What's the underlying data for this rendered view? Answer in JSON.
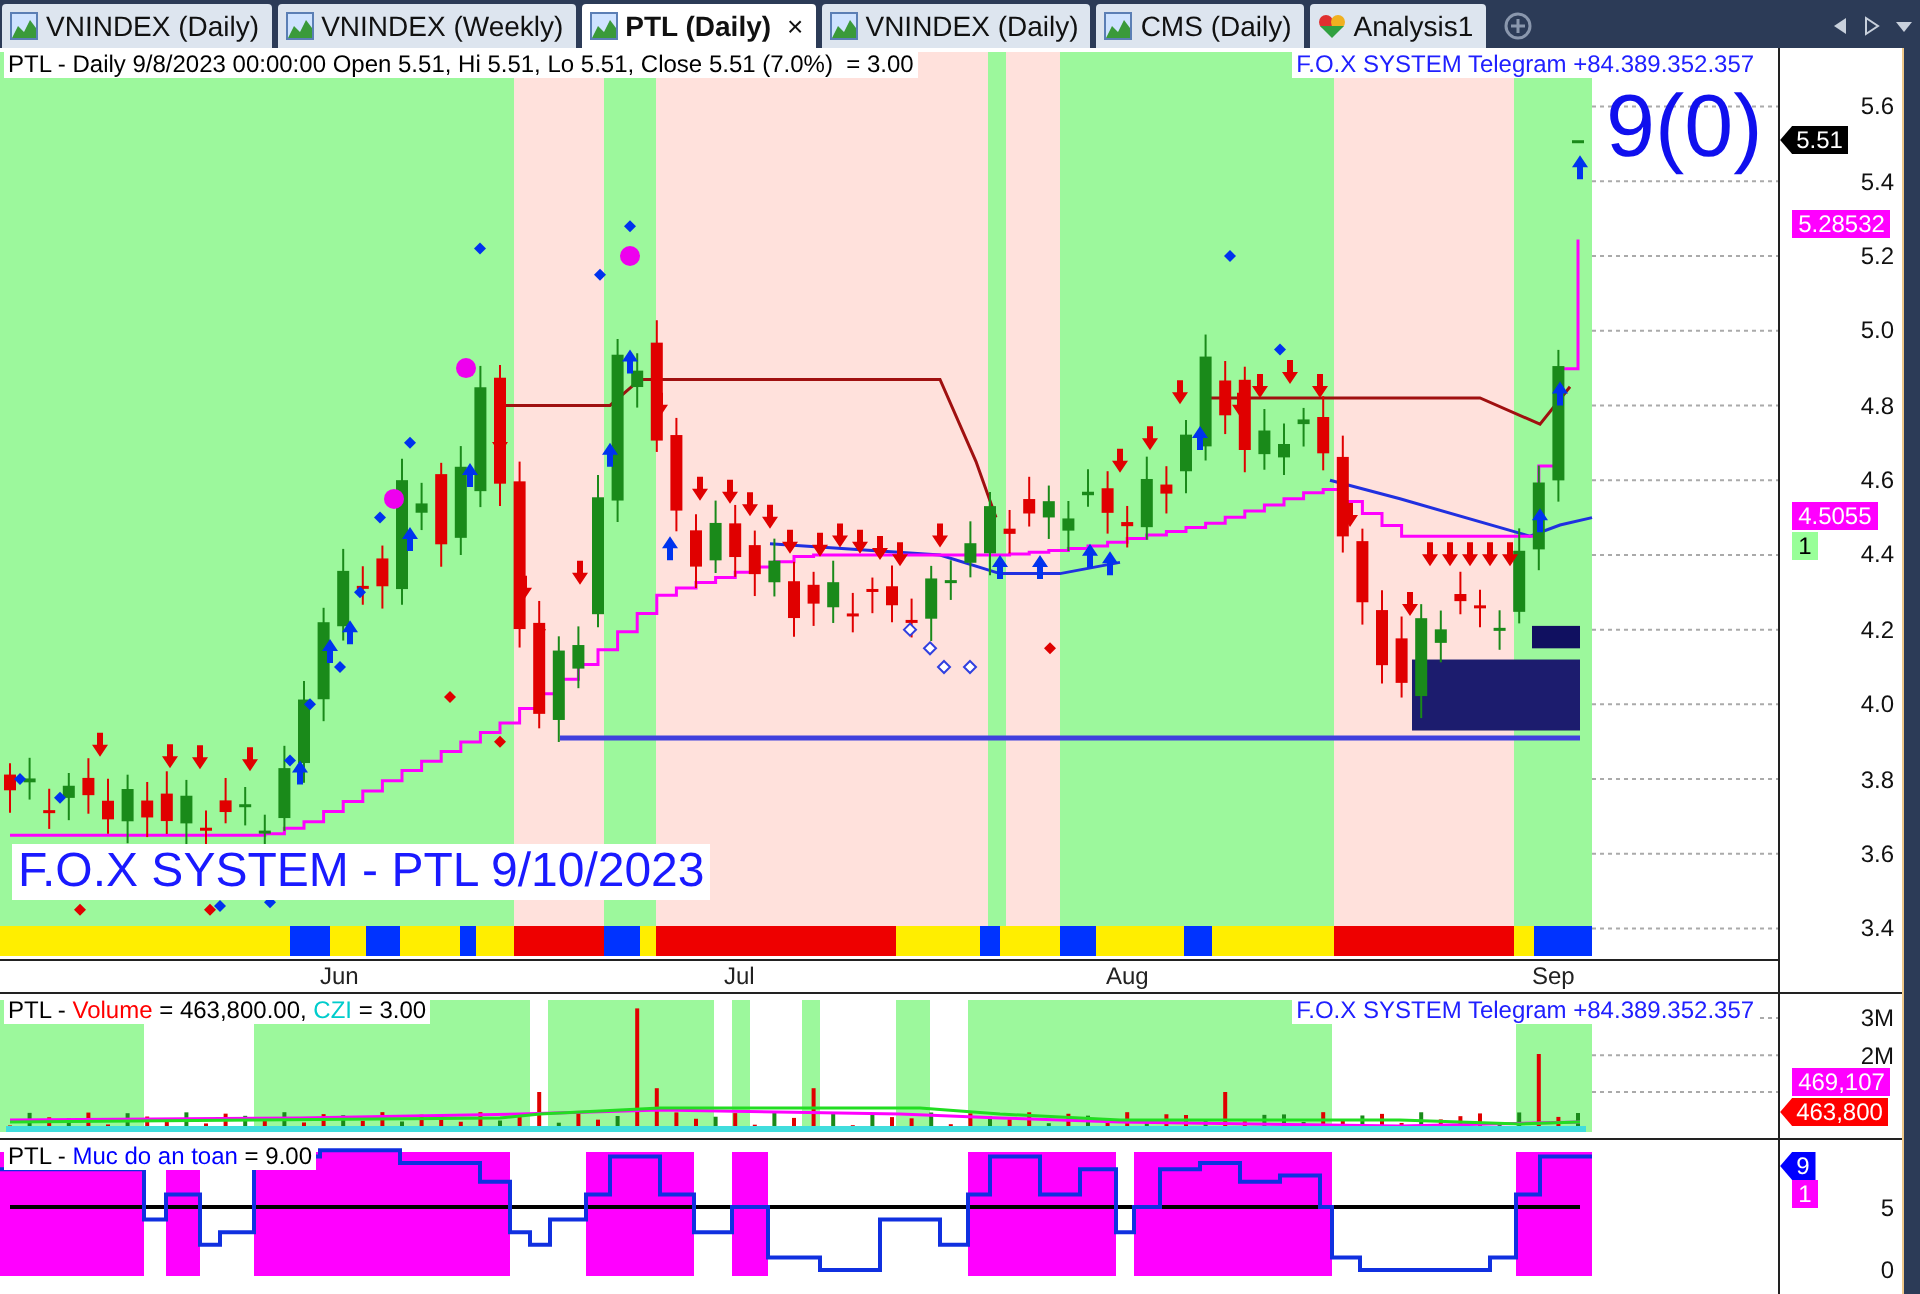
{
  "tabs": [
    {
      "label": "VNINDEX (Daily)",
      "selected": false,
      "kind": "chart"
    },
    {
      "label": "VNINDEX (Weekly)",
      "selected": false,
      "kind": "chart"
    },
    {
      "label": "PTL (Daily)",
      "selected": true,
      "kind": "chart",
      "close": "×"
    },
    {
      "label": "VNINDEX (Daily)",
      "selected": false,
      "kind": "chart"
    },
    {
      "label": "CMS (Daily)",
      "selected": false,
      "kind": "chart"
    },
    {
      "label": "Analysis1",
      "selected": false,
      "kind": "analysis"
    }
  ],
  "price_panel": {
    "header": "PTL - Daily 9/8/2023 00:00:00 Open 5.51, Hi 5.51, Lo 5.51, Close 5.51 (7.0%)  = 3.00",
    "contact": "F.O.X SYSTEM Telegram +84.389.352.357",
    "count": "9(0)",
    "caption": "F.O.X SYSTEM - PTL 9/10/2023",
    "y_ticks": [
      "5.6",
      "5.4",
      "5.2",
      "5.0",
      "4.8",
      "4.6",
      "4.4",
      "4.2",
      "4.0",
      "3.8",
      "3.6",
      "3.4"
    ],
    "x_labels": [
      "Jun",
      "Jul",
      "Aug",
      "Sep"
    ],
    "badges": [
      {
        "text": "5.51",
        "color": "#000000",
        "pointer": true
      },
      {
        "text": "5.28532",
        "color": "#ff00ff",
        "pointer": false
      },
      {
        "text": "4.5055",
        "color": "#ff00ff",
        "pointer": false
      },
      {
        "text": "1",
        "color": "#99ff99",
        "pointer": false
      }
    ]
  },
  "volume_panel": {
    "header": [
      {
        "text": "PTL - ",
        "color": "#000000"
      },
      {
        "text": "Volume",
        "color": "#ff0000"
      },
      {
        "text": " = 463,800.00, ",
        "color": "#000000"
      },
      {
        "text": "CZI",
        "color": "#00cccc"
      },
      {
        "text": " = 3.00",
        "color": "#000000"
      }
    ],
    "contact": "F.O.X SYSTEM Telegram +84.389.352.357",
    "y_ticks": [
      "3M",
      "2M"
    ],
    "badges": [
      {
        "text": "469,107",
        "color": "#ff00ff",
        "pointer": false
      },
      {
        "text": "463,800",
        "color": "#ff0000",
        "pointer": true
      }
    ]
  },
  "safety_panel": {
    "header": [
      {
        "text": "PTL - ",
        "color": "#000000"
      },
      {
        "text": "Muc do an toan",
        "color": "#0000ff"
      },
      {
        "text": " = 9.00",
        "color": "#000000"
      }
    ],
    "y_ticks": [
      "5",
      "0"
    ],
    "badges": [
      {
        "text": "9",
        "color": "#0000ff",
        "pointer": true
      },
      {
        "text": "1",
        "color": "#ff00ff",
        "pointer": false
      }
    ]
  }
}
